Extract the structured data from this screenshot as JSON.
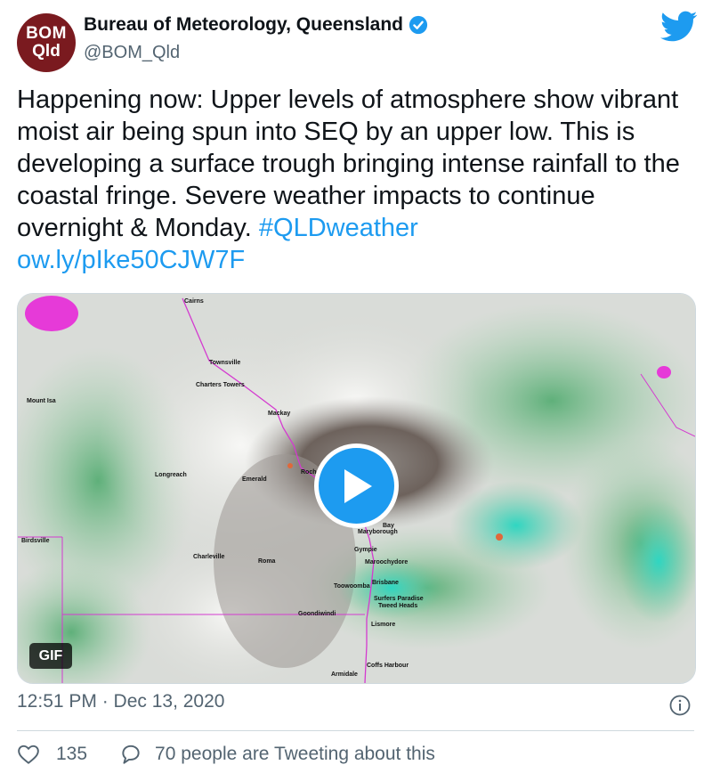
{
  "account": {
    "avatar_line1": "BOM",
    "avatar_line2": "Qld",
    "display_name": "Bureau of Meteorology, Queensland",
    "handle": "@BOM_Qld"
  },
  "tweet": {
    "text_main": "Happening now: Upper levels of atmosphere show vibrant moist air being spun into SEQ by an upper low. This is developing a surface trough  bringing intense rainfall to the coastal fringe. Severe weather impacts to continue overnight & Monday.",
    "hashtag": "#QLDweather",
    "link": "ow.ly/pIke50CJW7F"
  },
  "media": {
    "badge": "GIF",
    "map_labels": {
      "cairns": "Cairns",
      "townsville": "Townsville",
      "charters_towers": "Charters Towers",
      "mount_isa": "Mount Isa",
      "mackay": "Mackay",
      "longreach": "Longreach",
      "emerald": "Emerald",
      "rockhampton": "Roch",
      "birdsville": "Birdsville",
      "charleville": "Charleville",
      "roma": "Roma",
      "hervey_bay": "Bay",
      "maryborough": "Maryborough",
      "gympie": "Gympie",
      "maroochydore": "Maroochydore",
      "toowoomba": "Toowoomba",
      "brisbane": "Brisbane",
      "surfers_paradise": "Surfers Paradise",
      "tweed_heads": "Tweed Heads",
      "goondiwindi": "Goondiwindi",
      "lismore": "Lismore",
      "coffs_harbour": "Coffs Harbour",
      "armidale": "Armidale"
    }
  },
  "meta": {
    "timestamp": "12:51 PM · Dec 13, 2020"
  },
  "actions": {
    "like_count": "135",
    "reply_label": "70 people are Tweeting about this"
  },
  "colors": {
    "accent": "#1d9bf0",
    "avatar_bg": "#7a1a1f",
    "text_secondary": "#536471"
  }
}
